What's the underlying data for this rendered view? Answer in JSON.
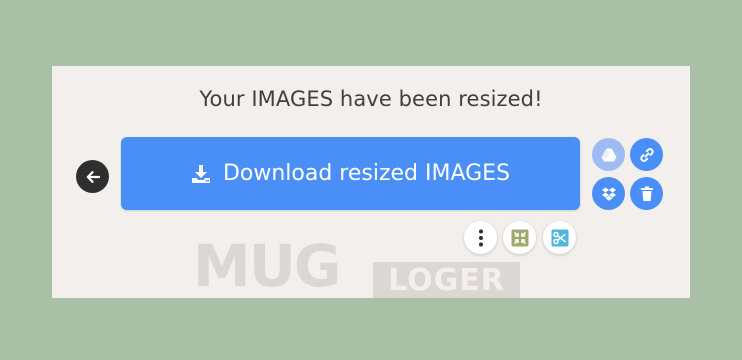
{
  "title": "Your IMAGES have been resized!",
  "download_button": {
    "label": "Download resized IMAGES",
    "icon": "download-icon"
  },
  "back_button": {
    "icon": "arrow-left-icon"
  },
  "share_buttons": [
    {
      "name": "google-drive",
      "icon": "google-drive-icon"
    },
    {
      "name": "copy-link",
      "icon": "link-icon"
    },
    {
      "name": "dropbox",
      "icon": "dropbox-icon"
    },
    {
      "name": "delete",
      "icon": "trash-icon"
    }
  ],
  "tool_buttons": [
    {
      "name": "more",
      "icon": "more-vertical-icon"
    },
    {
      "name": "compress",
      "icon": "compress-icon"
    },
    {
      "name": "crop",
      "icon": "scissors-icon"
    }
  ],
  "watermark": {
    "part1": "MUG",
    "part2": "LOGER"
  },
  "colors": {
    "background": "#a9c0a6",
    "panel": "#f2efed",
    "accent": "#4a8ff7",
    "dark": "#2f2f2f"
  }
}
